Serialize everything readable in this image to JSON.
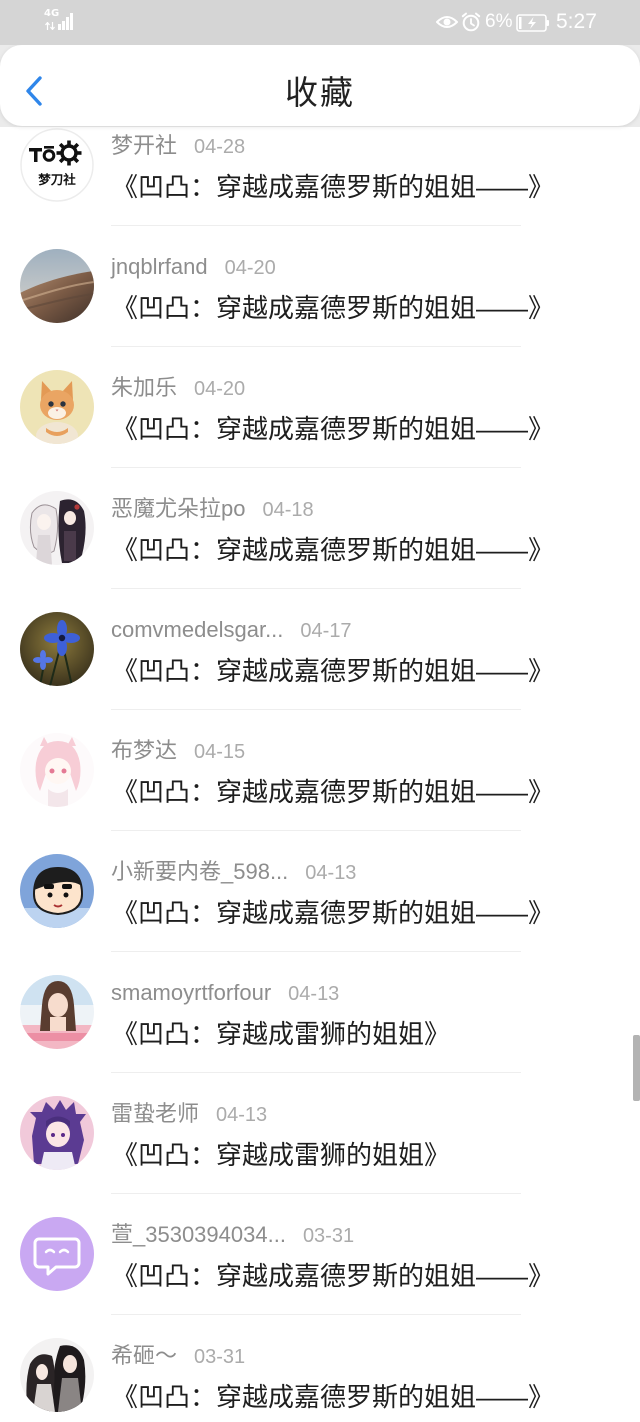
{
  "status_bar": {
    "network": "4G",
    "battery": "6%",
    "time": "5:27"
  },
  "header": {
    "title": "收藏",
    "back_icon": "back-arrow-icon"
  },
  "colors": {
    "accent": "#2f86ea",
    "status_bar_bg": "#d5d5d5",
    "name_text": "#8d8d8d",
    "date_text": "#ababab",
    "title_text": "#1e1e1e",
    "divider": "#eeeeee"
  },
  "list": {
    "items": [
      {
        "name": "梦开社",
        "date": "04-28",
        "title": "《凹凸：穿越成嘉德罗斯的姐姐——》",
        "avatar_text": "梦刀社"
      },
      {
        "name": "jnqblrfand",
        "date": "04-20",
        "title": "《凹凸：穿越成嘉德罗斯的姐姐——》"
      },
      {
        "name": "朱加乐",
        "date": "04-20",
        "title": "《凹凸：穿越成嘉德罗斯的姐姐——》"
      },
      {
        "name": "恶魔尤朵拉po",
        "date": "04-18",
        "title": "《凹凸：穿越成嘉德罗斯的姐姐——》"
      },
      {
        "name": "comvmedelsgar...",
        "date": "04-17",
        "title": "《凹凸：穿越成嘉德罗斯的姐姐——》"
      },
      {
        "name": "布梦达",
        "date": "04-15",
        "title": "《凹凸：穿越成嘉德罗斯的姐姐——》"
      },
      {
        "name": "小新要内卷_598...",
        "date": "04-13",
        "title": "《凹凸：穿越成嘉德罗斯的姐姐——》"
      },
      {
        "name": "smamoyrtforfour",
        "date": "04-13",
        "title": "《凹凸：穿越成雷狮的姐姐》"
      },
      {
        "name": "雷蛰老师",
        "date": "04-13",
        "title": "《凹凸：穿越成雷狮的姐姐》"
      },
      {
        "name": "萱_3530394034...",
        "date": "03-31",
        "title": "《凹凸：穿越成嘉德罗斯的姐姐——》"
      },
      {
        "name": "希砸～",
        "date": "03-31",
        "title": "《凹凸：穿越成嘉德罗斯的姐姐——》"
      }
    ]
  }
}
